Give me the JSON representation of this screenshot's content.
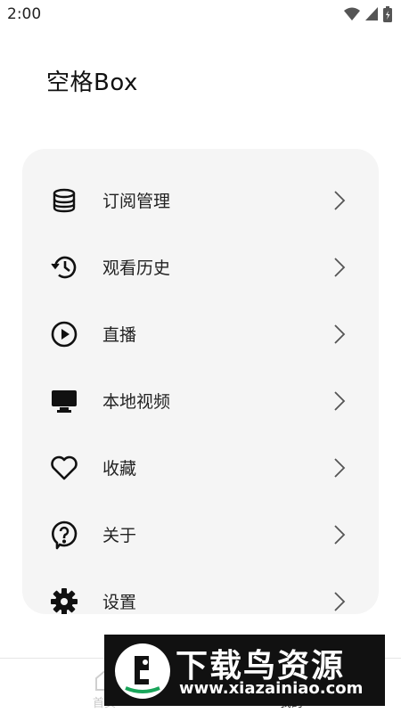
{
  "status": {
    "time": "2:00"
  },
  "app": {
    "title": "空格Box"
  },
  "menu": {
    "items": [
      {
        "label": "订阅管理",
        "icon": "database-icon"
      },
      {
        "label": "观看历史",
        "icon": "history-icon"
      },
      {
        "label": "直播",
        "icon": "play-circle-icon"
      },
      {
        "label": "本地视频",
        "icon": "monitor-icon"
      },
      {
        "label": "收藏",
        "icon": "heart-icon"
      },
      {
        "label": "关于",
        "icon": "help-bubble-icon"
      },
      {
        "label": "设置",
        "icon": "gear-icon"
      }
    ]
  },
  "bottom_nav": {
    "home_label": "首页",
    "mine_label": "我的"
  },
  "watermark": {
    "title": "下载鸟资源",
    "url": "www.xiazainiao.com"
  }
}
